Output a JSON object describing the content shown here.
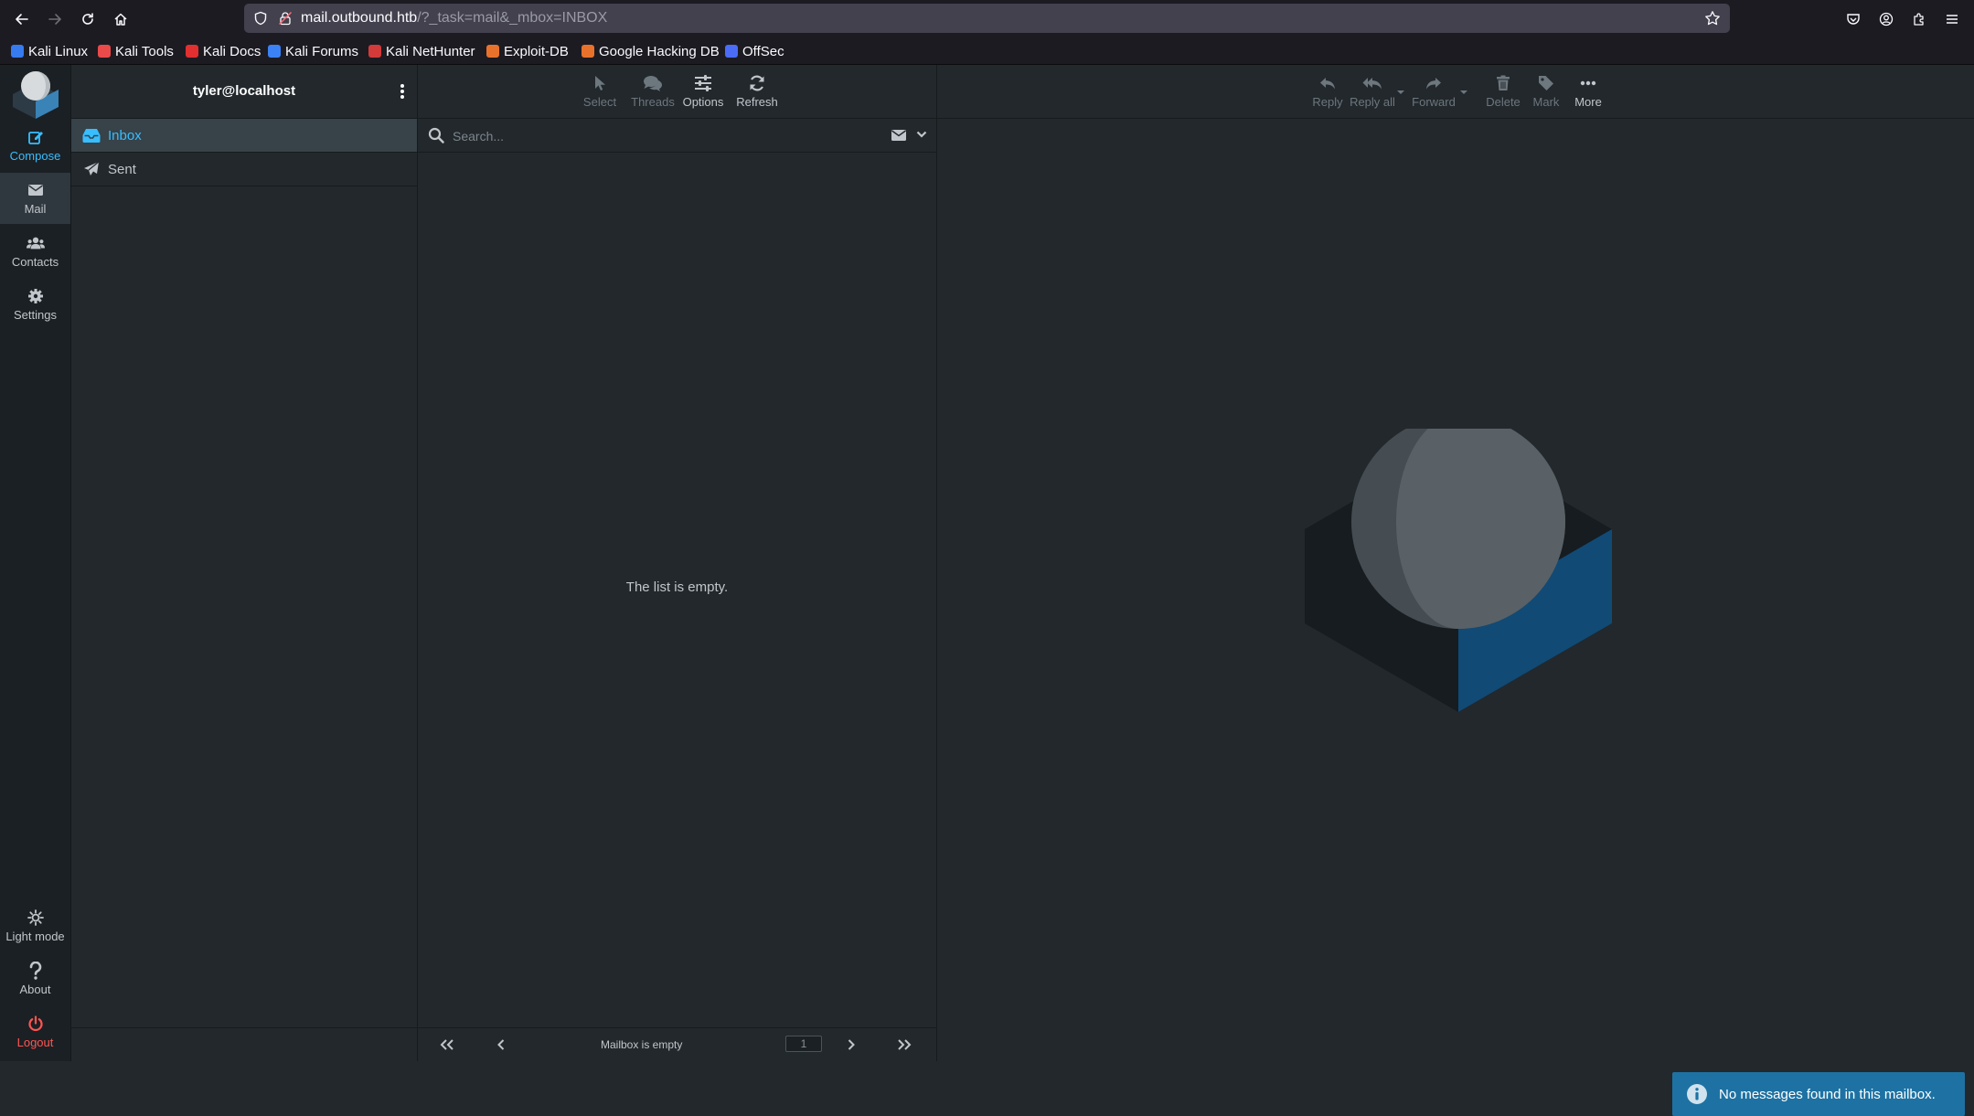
{
  "browser": {
    "url_host": "mail.outbound.htb",
    "url_rest": "/?_task=mail&_mbox=INBOX",
    "bookmarks": [
      {
        "label": "Kali Linux",
        "color": "#367bf0"
      },
      {
        "label": "Kali Tools",
        "color": "#ea4a4a"
      },
      {
        "label": "Kali Docs",
        "color": "#e22f2f"
      },
      {
        "label": "Kali Forums",
        "color": "#3b82f6"
      },
      {
        "label": "Kali NetHunter",
        "color": "#d33a3a"
      },
      {
        "label": "Exploit-DB",
        "color": "#e8722c"
      },
      {
        "label": "Google Hacking DB",
        "color": "#e8722c"
      },
      {
        "label": "OffSec",
        "color": "#4a6cf7"
      }
    ]
  },
  "taskmenu": {
    "compose": "Compose",
    "mail": "Mail",
    "contacts": "Contacts",
    "settings": "Settings",
    "light_mode": "Light mode",
    "about": "About",
    "logout": "Logout"
  },
  "folders": {
    "account": "tyler@localhost",
    "items": [
      {
        "label": "Inbox",
        "icon": "inbox-icon",
        "selected": true
      },
      {
        "label": "Sent",
        "icon": "paper-plane-icon",
        "selected": false
      }
    ]
  },
  "list": {
    "toolbar": {
      "select": "Select",
      "threads": "Threads",
      "options": "Options",
      "refresh": "Refresh"
    },
    "search_placeholder": "Search...",
    "empty_message": "The list is empty.",
    "status": "Mailbox is empty",
    "page": "1"
  },
  "content": {
    "toolbar": {
      "reply": "Reply",
      "reply_all": "Reply all",
      "forward": "Forward",
      "delete": "Delete",
      "mark": "Mark",
      "more": "More"
    }
  },
  "notification": "No messages found in this mailbox.",
  "colors": {
    "accent": "#37beff",
    "logout": "#ff5552",
    "notification": "#1d72a3",
    "background": "#22282c"
  }
}
